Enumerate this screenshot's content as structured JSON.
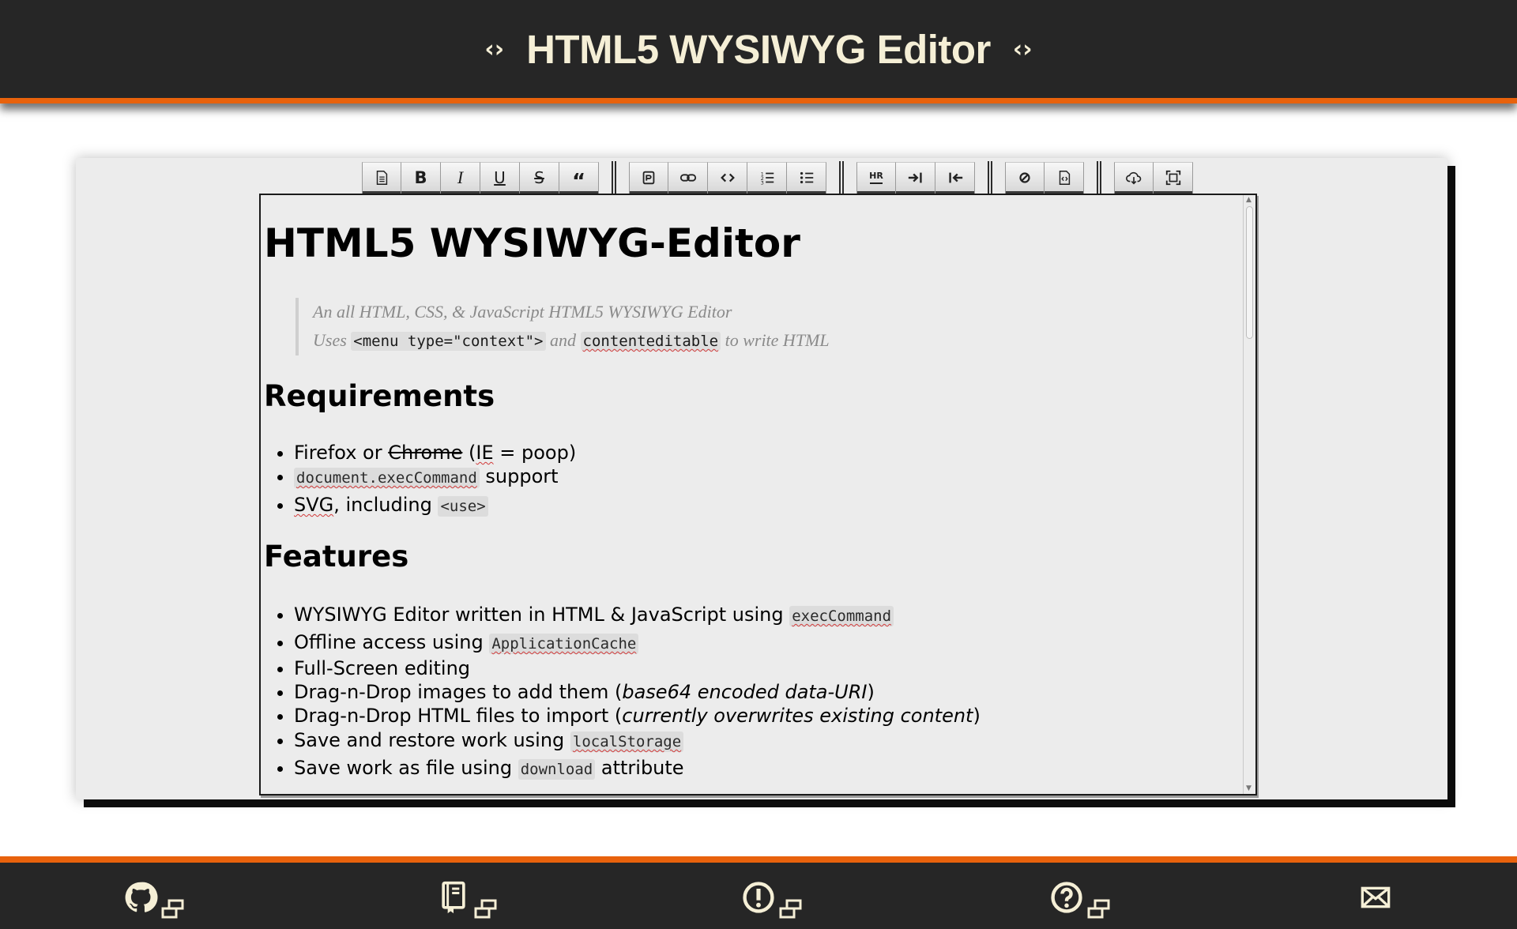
{
  "header": {
    "title": "HTML5 WYSIWYG Editor",
    "left_icon": "code-icon",
    "right_icon": "code-icon",
    "accent_color": "#e8620c",
    "background_color": "#262626"
  },
  "toolbar": {
    "groups": [
      [
        "new-document",
        "bold",
        "italic",
        "underline",
        "strikethrough",
        "quote"
      ],
      [
        "select-all",
        "link",
        "code",
        "ordered-list",
        "unordered-list"
      ],
      [
        "horizontal-rule",
        "indent",
        "outdent"
      ],
      [
        "clear-formatting",
        "view-source"
      ],
      [
        "save-cloud",
        "fullscreen"
      ]
    ],
    "bold_label": "B",
    "italic_label": "I",
    "underline_label": "U",
    "strike_label": "S",
    "quote_label": "“",
    "hr_label": "HR"
  },
  "document": {
    "title": "HTML5 WYSIWYG-Editor",
    "intro_line1": "An all HTML, CSS, & JavaScript HTML5 WYSIWYG Editor",
    "intro_line2_prefix": "Uses ",
    "intro_code1": "<menu type=\"context\">",
    "intro_line2_mid": " and ",
    "intro_code2": "contenteditable",
    "intro_line2_suffix": " to write HTML",
    "requirements_heading": "Requirements",
    "requirements": {
      "item1_a": "Firefox or ",
      "item1_strike": "Chrome",
      "item1_b": " (",
      "item1_ie": "IE",
      "item1_c": " = poop)",
      "item2_code": "document.execCommand",
      "item2_text": " support",
      "item3_svg": "SVG",
      "item3_text": ", including ",
      "item3_code": "<use>"
    },
    "features_heading": "Features",
    "features": {
      "f1_text": "WYSIWYG Editor written in HTML & JavaScript using ",
      "f1_code": "execCommand",
      "f2_text": "Offline access using ",
      "f2_code": "ApplicationCache",
      "f3_text": "Full-Screen editing",
      "f4_text": "Drag-n-Drop images to add them (",
      "f4_em": "base64 encoded data-URI",
      "f4_end": ")",
      "f5_text": "Drag-n-Drop HTML files to import (",
      "f5_em": "currently overwrites existing content",
      "f5_end": ")",
      "f6_text": "Save and restore work using ",
      "f6_code": "localStorage",
      "f7_text": "Save work as file using ",
      "f7_code": "download",
      "f7_end": " attribute"
    }
  },
  "footer": {
    "items": [
      "github-icon",
      "book-icon",
      "issue-icon",
      "help-icon",
      "mail-icon"
    ]
  }
}
